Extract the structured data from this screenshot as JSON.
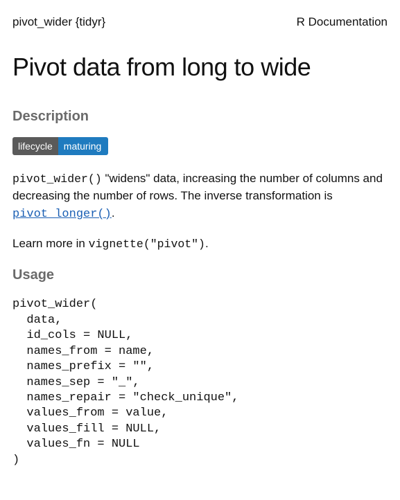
{
  "header": {
    "left": "pivot_wider {tidyr}",
    "right": "R Documentation"
  },
  "title": "Pivot data from long to wide",
  "sections": {
    "description_heading": "Description",
    "usage_heading": "Usage"
  },
  "badge": {
    "left": "lifecycle",
    "right": "maturing"
  },
  "description": {
    "code1": "pivot_wider()",
    "text1": " \"widens\" data, increasing the number of columns and decreasing the number of rows. The inverse transformation is ",
    "link_text": "pivot_longer()",
    "text2": ".",
    "learn_pre": "Learn more in ",
    "learn_code": "vignette(\"pivot\")",
    "learn_post": "."
  },
  "usage_code": "pivot_wider(\n  data,\n  id_cols = NULL,\n  names_from = name,\n  names_prefix = \"\",\n  names_sep = \"_\",\n  names_repair = \"check_unique\",\n  values_from = value,\n  values_fill = NULL,\n  values_fn = NULL\n)"
}
